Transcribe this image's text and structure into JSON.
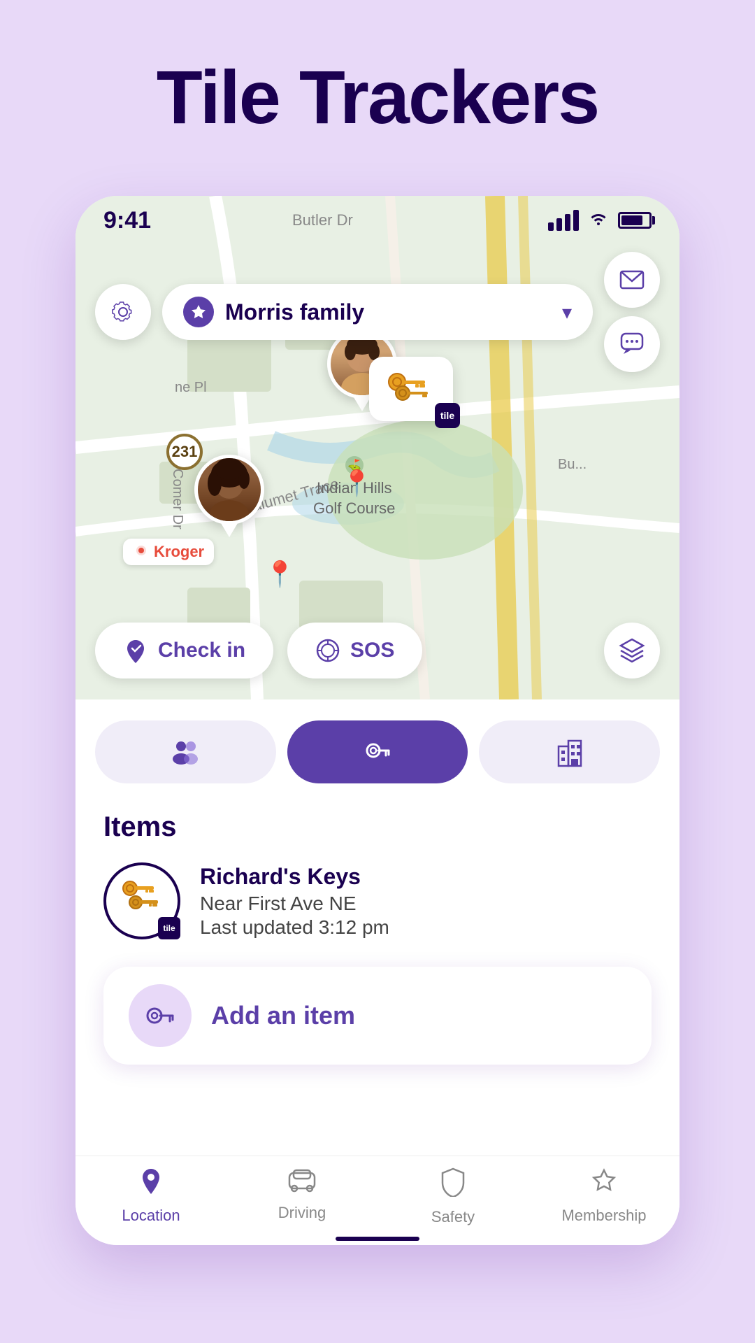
{
  "page": {
    "title": "Tile Trackers",
    "background_color": "#e8d9f8"
  },
  "status_bar": {
    "time": "9:41",
    "signal_label": "signal",
    "wifi_label": "wifi",
    "battery_label": "battery"
  },
  "header": {
    "settings_icon": "gear-icon",
    "family_name": "Morris family",
    "dropdown_icon": "chevron-down-icon",
    "mail_icon": "mail-icon",
    "chat_icon": "chat-icon"
  },
  "map": {
    "check_in_label": "Check in",
    "sos_label": "SOS",
    "layers_icon": "layers-icon",
    "checkin_icon": "checkin-icon",
    "sos_icon": "sos-icon",
    "avatar_man_alt": "Richard avatar",
    "avatar_woman_alt": "Family member avatar",
    "kroger_label": "Kroger",
    "route_231": "231",
    "indian_hills_label": "Indian Hills\nGolf Course",
    "calumet_trace_label": "Calumet Trace"
  },
  "tabs": [
    {
      "id": "people",
      "icon": "people-icon",
      "active": false
    },
    {
      "id": "tracker",
      "icon": "key-icon",
      "active": true
    },
    {
      "id": "places",
      "icon": "building-icon",
      "active": false
    }
  ],
  "items_section": {
    "title": "Items",
    "items": [
      {
        "name": "Richard's Keys",
        "location": "Near First Ave NE",
        "last_updated": "Last updated 3:12 pm",
        "icon": "🔑"
      }
    ]
  },
  "add_item": {
    "label": "Add an item",
    "icon": "key-icon"
  },
  "bottom_nav": {
    "items": [
      {
        "id": "location",
        "label": "Location",
        "icon": "location-icon",
        "active": true
      },
      {
        "id": "driving",
        "label": "Driving",
        "icon": "driving-icon",
        "active": false
      },
      {
        "id": "safety",
        "label": "Safety",
        "icon": "safety-icon",
        "active": false
      },
      {
        "id": "membership",
        "label": "Membership",
        "icon": "membership-icon",
        "active": false
      }
    ]
  }
}
